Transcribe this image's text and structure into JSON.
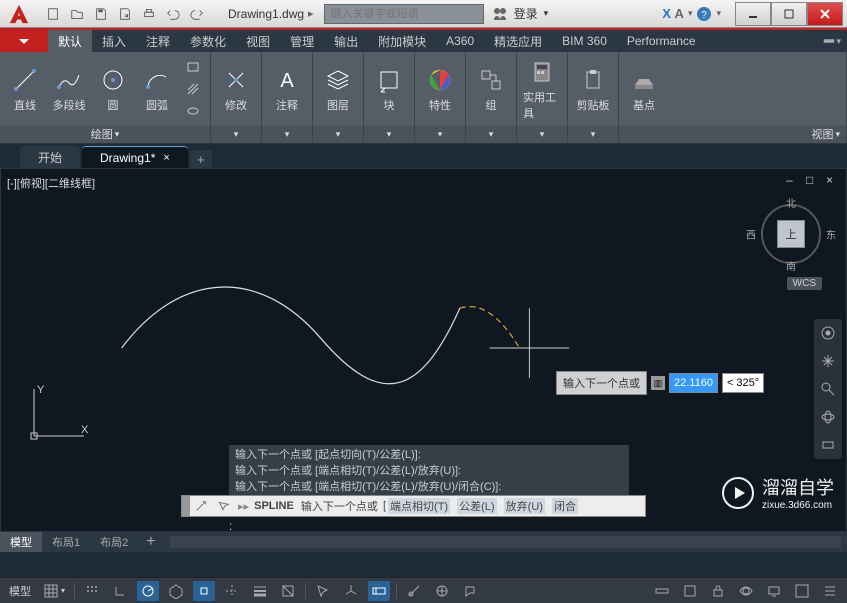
{
  "title": "Drawing1.dwg",
  "search_placeholder": "键入关键字或短语",
  "login_label": "登录",
  "xa_label": "X",
  "xa_sub": "A",
  "menu_tabs": [
    "默认",
    "插入",
    "注释",
    "参数化",
    "视图",
    "管理",
    "输出",
    "附加模块",
    "A360",
    "精选应用",
    "BIM 360",
    "Performance"
  ],
  "ribbon": {
    "draw": {
      "label": "绘图",
      "line": "直线",
      "polyline": "多段线",
      "circle": "圆",
      "arc": "圆弧"
    },
    "modify": {
      "label": "修改"
    },
    "annotate": {
      "label": "注释"
    },
    "layers": {
      "label": "图层"
    },
    "block": {
      "label": "块"
    },
    "properties": {
      "label": "特性"
    },
    "group": {
      "label": "组"
    },
    "utilities": {
      "label": "实用工具"
    },
    "clipboard": {
      "label": "剪贴板"
    },
    "base": {
      "label": "基点"
    },
    "view": {
      "label": "视图"
    }
  },
  "filetabs": {
    "start": "开始",
    "drawing": "Drawing1*"
  },
  "viewport_label": "[-][俯视][二维线框]",
  "viewcube": {
    "face": "上",
    "n": "北",
    "s": "南",
    "e": "东",
    "w": "西"
  },
  "wcs": "WCS",
  "dyninput": {
    "label": "输入下一个点或",
    "dist": "22.1160",
    "angle": "< 325°"
  },
  "cmd_history": [
    "输入下一个点或 [起点切向(T)/公差(L)]:",
    "输入下一个点或 [端点相切(T)/公差(L)/放弃(U)]:",
    "输入下一个点或 [端点相切(T)/公差(L)/放弃(U)/闭合(C)]:"
  ],
  "cmdline": {
    "cmd": "SPLINE",
    "prompt": "输入下一个点或",
    "opts": [
      "端点相切(T)",
      "公差(L)",
      "放弃(U)",
      "闭合"
    ]
  },
  "layout_tabs": [
    "模型",
    "布局1",
    "布局2"
  ],
  "status": {
    "model": "模型"
  },
  "watermark": {
    "brand": "溜溜自学",
    "url": "zixue.3d66.com"
  }
}
